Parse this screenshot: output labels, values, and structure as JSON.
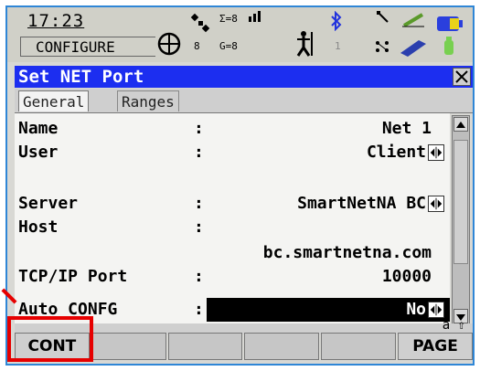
{
  "status": {
    "time": "17:23",
    "mode": "CONFIGURE",
    "sat_sum": "Σ=8",
    "sat_8": "8",
    "sat_g": "G=8",
    "radio_num": "1",
    "icons": [
      "crosshair-icon",
      "satellite-icon",
      "antenna-icon",
      "bluetooth-icon",
      "link-icon",
      "pen-icon",
      "sd-card-icon",
      "battery-icon"
    ]
  },
  "title": "Set NET Port",
  "tabs": [
    {
      "label": "General",
      "active": true
    },
    {
      "label": "Ranges",
      "active": false
    }
  ],
  "form": {
    "rows": [
      {
        "label": "Name",
        "value": "Net 1",
        "arrows": false,
        "highlight": false
      },
      {
        "label": "User",
        "value": "Client",
        "arrows": true,
        "highlight": false
      },
      {
        "label": "",
        "value": "",
        "arrows": false,
        "highlight": false
      },
      {
        "label": "Server",
        "value": "SmartNetNA BC",
        "arrows": true,
        "highlight": false
      },
      {
        "label": "Host",
        "value": "",
        "arrows": false,
        "highlight": false
      },
      {
        "label": "",
        "value": "bc.smartnetna.com",
        "arrows": false,
        "highlight": false,
        "colon": false
      },
      {
        "label": "TCP/IP Port",
        "value": "10000",
        "arrows": false,
        "highlight": false
      },
      {
        "label": "Auto CONFG",
        "value": "No",
        "arrows": true,
        "highlight": true
      }
    ]
  },
  "caps_indicator": "a ⇧",
  "fkeys": [
    "CONT",
    "",
    "",
    "",
    "",
    "PAGE"
  ],
  "colors": {
    "title_bg": "#1c2ef0",
    "annotation": "#e60000"
  }
}
